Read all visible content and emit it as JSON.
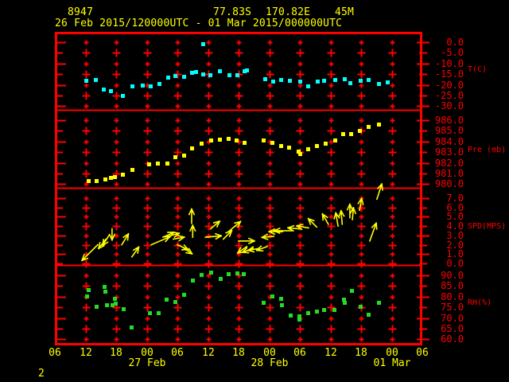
{
  "header": {
    "station_id": "8947",
    "latitude": "77.83S",
    "longitude": "170.82E",
    "elevation": "45M",
    "period": "26 Feb 2015/120000UTC - 01 Mar 2015/000000UTC"
  },
  "footer": {
    "page_label": "2"
  },
  "colors": {
    "background": "#000000",
    "frame_red": "#ff0000",
    "label_yellow": "#ffff00",
    "temperature": "#00ffff",
    "pressure": "#ffff00",
    "wind": "#ffff00",
    "humidity": "#22dd22"
  },
  "x_axis": {
    "note": "hours are offsets from 26 Feb 2015 06UTC; axis spans 72 h",
    "hour_labels": [
      "06",
      "12",
      "18",
      "00",
      "06",
      "12",
      "18",
      "00",
      "06",
      "12",
      "18",
      "00",
      "06"
    ],
    "date_labels": [
      {
        "label": "27 Feb",
        "hour": 18
      },
      {
        "label": "28 Feb",
        "hour": 42
      },
      {
        "label": "01 Mar",
        "hour": 66
      }
    ]
  },
  "chart_data": [
    {
      "type": "scatter",
      "name": "temperature",
      "label": "T(C)",
      "tick_labels": [
        "0.0",
        "-5.0",
        "-10.0",
        "-15.0",
        "-20.0",
        "-25.0",
        "-30.0"
      ],
      "tick_values": [
        0,
        -5,
        -10,
        -15,
        -20,
        -25,
        -30
      ],
      "points": [
        [
          6.1,
          -17.9
        ],
        [
          7.9,
          -17.5
        ],
        [
          9.5,
          -22.0
        ],
        [
          10.9,
          -22.8
        ],
        [
          13.2,
          -25.0
        ],
        [
          15.1,
          -20.5
        ],
        [
          17.1,
          -20.1
        ],
        [
          18.7,
          -20.5
        ],
        [
          20.4,
          -19.4
        ],
        [
          22.1,
          -16.4
        ],
        [
          23.5,
          -15.7
        ],
        [
          25.2,
          -16.0
        ],
        [
          26.8,
          -14.3
        ],
        [
          27.6,
          -13.8
        ],
        [
          29.0,
          -0.9
        ],
        [
          29.0,
          -14.8
        ],
        [
          30.4,
          -15.2
        ],
        [
          32.3,
          -13.3
        ],
        [
          34.1,
          -15.2
        ],
        [
          35.7,
          -15.2
        ],
        [
          37.1,
          -13.5
        ],
        [
          37.6,
          -12.9
        ],
        [
          41.1,
          -17.2
        ],
        [
          42.7,
          -18.3
        ],
        [
          44.3,
          -17.5
        ],
        [
          46.0,
          -17.9
        ],
        [
          48.0,
          -18.3
        ],
        [
          49.5,
          -20.5
        ],
        [
          51.4,
          -18.3
        ],
        [
          52.7,
          -17.9
        ],
        [
          54.9,
          -17.5
        ],
        [
          56.7,
          -17.2
        ],
        [
          57.8,
          -19.0
        ],
        [
          59.8,
          -17.9
        ],
        [
          61.4,
          -17.5
        ],
        [
          63.4,
          -19.4
        ],
        [
          65.1,
          -18.7
        ]
      ]
    },
    {
      "type": "scatter",
      "name": "pressure",
      "label": "Pre (mb)",
      "tick_labels": [
        "986.0",
        "985.0",
        "984.0",
        "983.0",
        "982.0",
        "981.0",
        "980.0"
      ],
      "tick_values": [
        986,
        985,
        984,
        983,
        982,
        981,
        980
      ],
      "points": [
        [
          6.5,
          980.3
        ],
        [
          8.1,
          980.3
        ],
        [
          9.8,
          980.5
        ],
        [
          10.9,
          980.6
        ],
        [
          11.7,
          980.7
        ],
        [
          13.2,
          980.9
        ],
        [
          15.1,
          981.4
        ],
        [
          18.4,
          981.9
        ],
        [
          20.1,
          982.0
        ],
        [
          22.0,
          982.0
        ],
        [
          23.5,
          982.6
        ],
        [
          25.2,
          982.7
        ],
        [
          26.8,
          983.4
        ],
        [
          28.7,
          983.8
        ],
        [
          30.5,
          984.1
        ],
        [
          32.3,
          984.2
        ],
        [
          34.0,
          984.3
        ],
        [
          35.5,
          984.1
        ],
        [
          37.1,
          983.9
        ],
        [
          40.8,
          984.1
        ],
        [
          42.5,
          983.9
        ],
        [
          44.3,
          983.6
        ],
        [
          45.8,
          983.5
        ],
        [
          47.7,
          983.1
        ],
        [
          48.0,
          982.9
        ],
        [
          49.5,
          983.3
        ],
        [
          51.3,
          983.6
        ],
        [
          53.0,
          983.8
        ],
        [
          54.9,
          984.1
        ],
        [
          56.4,
          984.7
        ],
        [
          58.0,
          984.7
        ],
        [
          59.7,
          985.0
        ],
        [
          61.4,
          985.4
        ],
        [
          63.4,
          985.6
        ]
      ]
    },
    {
      "type": "wind",
      "name": "wind_speed",
      "label": "SPD(MPS)",
      "tick_labels": [
        "7.0",
        "6.0",
        "5.0",
        "4.0",
        "3.0",
        "2.0",
        "1.0",
        "0.0"
      ],
      "tick_values": [
        7,
        6,
        5,
        4,
        3,
        2,
        1,
        0
      ],
      "arrow_note": "points are [hour, speed_mps, angle_deg_math (0=east, 90=up), arrow_len_px]",
      "points": [
        [
          8.4,
          2.0,
          225,
          28
        ],
        [
          10.0,
          2.6,
          232,
          15
        ],
        [
          10.6,
          3.0,
          238,
          15
        ],
        [
          11.2,
          3.7,
          270,
          14
        ],
        [
          13.1,
          2.0,
          58,
          16
        ],
        [
          15.1,
          0.7,
          55,
          15
        ],
        [
          18.9,
          2.0,
          23,
          25
        ],
        [
          21.2,
          2.8,
          25,
          15
        ],
        [
          22.1,
          2.9,
          15,
          15
        ],
        [
          23.2,
          2.6,
          10,
          14
        ],
        [
          24.0,
          2.0,
          -25,
          15
        ],
        [
          25.1,
          1.7,
          -35,
          14
        ],
        [
          26.8,
          4.3,
          90,
          18
        ],
        [
          27.0,
          2.8,
          90,
          15
        ],
        [
          29.5,
          2.8,
          5,
          20
        ],
        [
          30.5,
          3.7,
          40,
          15
        ],
        [
          33.0,
          2.6,
          45,
          15
        ],
        [
          34.0,
          3.4,
          40,
          20
        ],
        [
          36.0,
          2.4,
          0,
          20
        ],
        [
          37.6,
          1.8,
          215,
          14
        ],
        [
          38.8,
          1.6,
          200,
          14
        ],
        [
          40.0,
          1.6,
          190,
          14
        ],
        [
          41.6,
          1.8,
          200,
          14
        ],
        [
          42.9,
          2.9,
          185,
          15
        ],
        [
          44.6,
          3.4,
          180,
          17
        ],
        [
          46.4,
          3.5,
          180,
          22
        ],
        [
          48.0,
          3.7,
          175,
          15
        ],
        [
          49.7,
          3.8,
          170,
          15
        ],
        [
          51.3,
          3.9,
          135,
          15
        ],
        [
          53.6,
          4.2,
          120,
          15
        ],
        [
          55.5,
          4.0,
          100,
          17
        ],
        [
          56.3,
          4.2,
          95,
          17
        ],
        [
          57.8,
          4.9,
          90,
          17
        ],
        [
          58.3,
          4.7,
          85,
          15
        ],
        [
          59.7,
          5.7,
          80,
          15
        ],
        [
          61.7,
          2.4,
          70,
          24
        ],
        [
          63.1,
          6.9,
          72,
          20
        ]
      ]
    },
    {
      "type": "scatter",
      "name": "relative_humidity",
      "label": "RH(%)",
      "tick_labels": [
        "90.0",
        "85.0",
        "80.0",
        "75.0",
        "70.0",
        "65.0",
        "60.0"
      ],
      "tick_values": [
        90,
        85,
        80,
        75,
        70,
        65,
        60
      ],
      "points": [
        [
          6.3,
          80.3
        ],
        [
          6.5,
          83.3
        ],
        [
          8.1,
          75.4
        ],
        [
          9.7,
          84.8
        ],
        [
          9.8,
          82.5
        ],
        [
          10.1,
          76.2
        ],
        [
          11.2,
          76.2
        ],
        [
          11.7,
          79.2
        ],
        [
          11.9,
          76.9
        ],
        [
          13.4,
          74.3
        ],
        [
          15.0,
          65.9
        ],
        [
          18.5,
          72.5
        ],
        [
          20.3,
          72.3
        ],
        [
          21.8,
          78.8
        ],
        [
          23.5,
          77.6
        ],
        [
          25.3,
          81.0
        ],
        [
          26.9,
          87.9
        ],
        [
          28.7,
          90.4
        ],
        [
          30.5,
          91.4
        ],
        [
          32.4,
          88.5
        ],
        [
          34.0,
          90.7
        ],
        [
          35.7,
          91.2
        ],
        [
          37.0,
          90.7
        ],
        [
          40.9,
          77.3
        ],
        [
          42.6,
          80.3
        ],
        [
          44.2,
          79.2
        ],
        [
          44.4,
          76.2
        ],
        [
          46.1,
          71.3
        ],
        [
          47.8,
          71.0
        ],
        [
          47.9,
          69.5
        ],
        [
          49.6,
          72.5
        ],
        [
          51.3,
          73.2
        ],
        [
          52.7,
          74.0
        ],
        [
          54.7,
          74.0
        ],
        [
          56.5,
          78.8
        ],
        [
          56.7,
          77.3
        ],
        [
          58.2,
          82.9
        ],
        [
          59.8,
          75.4
        ],
        [
          61.4,
          71.7
        ],
        [
          63.4,
          77.3
        ]
      ]
    }
  ]
}
